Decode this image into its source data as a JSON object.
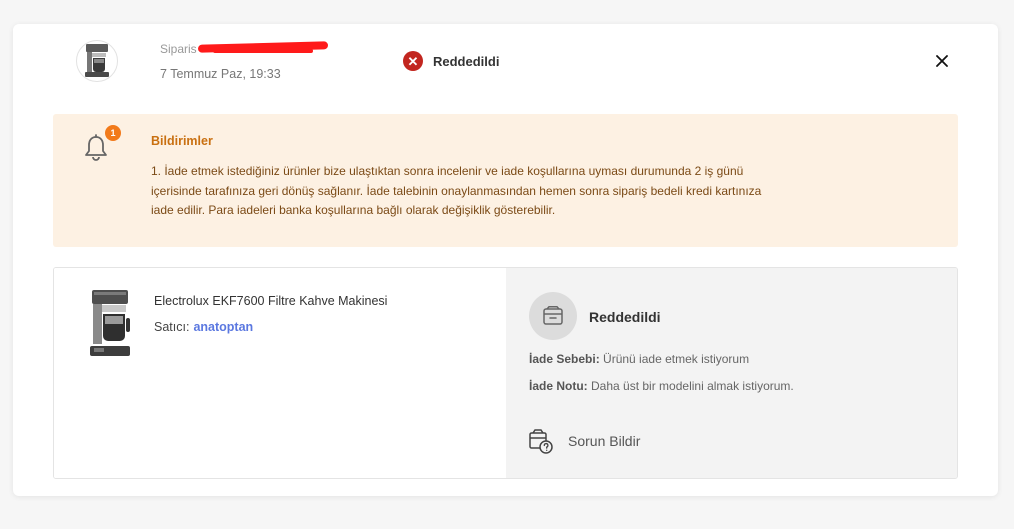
{
  "header": {
    "order_label": "Siparis",
    "order_date": "7 Temmuz Paz, 19:33",
    "status": "Reddedildi"
  },
  "notice": {
    "badge_count": "1",
    "title": "Bildirimler",
    "text": "1. İade etmek istediğiniz ürünler bize ulaştıktan sonra incelenir ve iade koşullarına uyması durumunda 2 iş günü içerisinde tarafınıza geri dönüş sağlanır. İade talebinin onaylanmasından hemen sonra sipariş bedeli kredi kartınıza iade edilir. Para iadeleri banka koşullarına bağlı olarak değişiklik gösterebilir."
  },
  "product": {
    "name": "Electrolux EKF7600 Filtre Kahve Makinesi",
    "seller_label": "Satıcı:",
    "seller_name": "anatoptan"
  },
  "return_info": {
    "status": "Reddedildi",
    "reason_label": "İade Sebebi:",
    "reason_value": "Ürünü iade etmek istiyorum",
    "note_label": "İade Notu:",
    "note_value": "Daha üst bir modelini almak istiyorum.",
    "report_label": "Sorun Bildir"
  },
  "colors": {
    "rejected": "#c2261f",
    "notice_bg": "#fdf1e3",
    "notice_title": "#c97011",
    "badge": "#f27a1a",
    "seller_link": "#5b78e0"
  },
  "icons": [
    "coffee-maker-thumbnail",
    "x-circle-icon",
    "close-icon",
    "bell-icon",
    "box-icon",
    "report-box-icon"
  ]
}
